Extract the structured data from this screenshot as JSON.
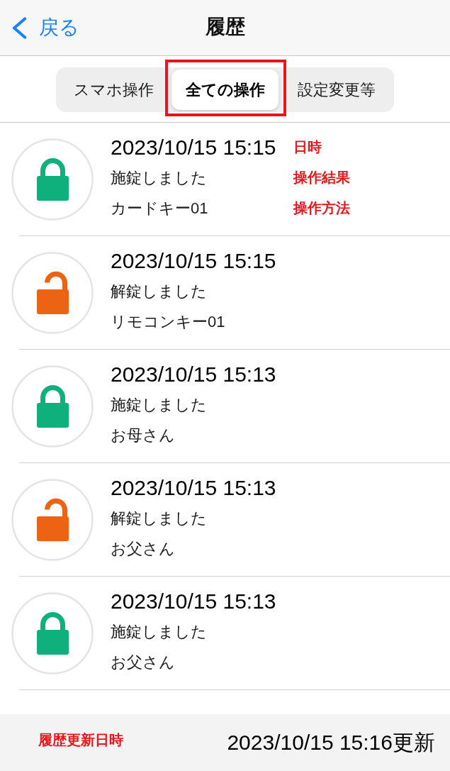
{
  "nav_bar": {
    "back_label": "戻る",
    "title": "履歴"
  },
  "segmented_control": {
    "segments": [
      {
        "label": "スマホ操作",
        "selected": false,
        "outlined": false
      },
      {
        "label": "全ての操作",
        "selected": true,
        "outlined": true
      },
      {
        "label": "設定変更等",
        "selected": false,
        "outlined": false
      }
    ]
  },
  "history": [
    {
      "kind": "locked",
      "datetime": "2023/10/15 15:15",
      "result": "施錠しました",
      "method": "カードキー01",
      "notes": [
        "日時",
        "操作結果",
        "操作方法"
      ]
    },
    {
      "kind": "unlocked",
      "datetime": "2023/10/15 15:15",
      "result": "解錠しました",
      "method": "リモコンキー01"
    },
    {
      "kind": "locked",
      "datetime": "2023/10/15 15:13",
      "result": "施錠しました",
      "method": "お母さん"
    },
    {
      "kind": "unlocked",
      "datetime": "2023/10/15 15:13",
      "result": "解錠しました",
      "method": "お父さん"
    },
    {
      "kind": "locked",
      "datetime": "2023/10/15 15:13",
      "result": "施錠しました",
      "method": "お父さん"
    }
  ],
  "footer": {
    "note": "履歴更新日時",
    "updated": "2023/10/15 15:16更新"
  }
}
